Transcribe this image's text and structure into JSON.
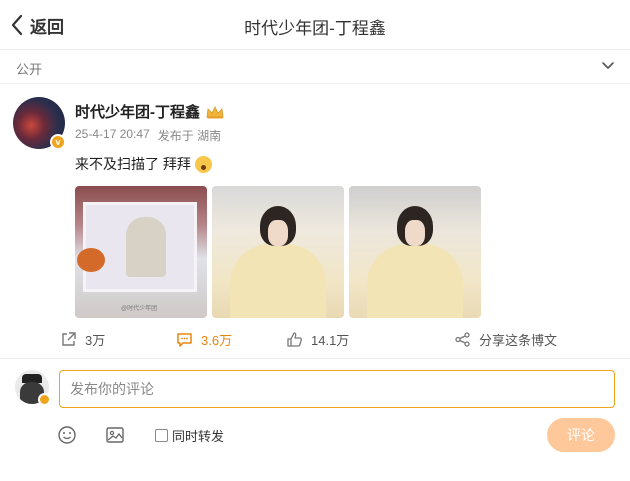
{
  "header": {
    "back_label": "返回",
    "title": "时代少年团-丁程鑫"
  },
  "visibility": {
    "label": "公开"
  },
  "post": {
    "author": "时代少年团-丁程鑫",
    "date": "25-4-17 20:47",
    "source": "发布于 湖南",
    "text": "来不及扫描了 拜拜",
    "image_watermark": "@时代少年团"
  },
  "actions": {
    "share_count": "3万",
    "comment_count": "3.6万",
    "like_count": "14.1万",
    "share_label": "分享这条博文"
  },
  "comment_box": {
    "placeholder": "发布你的评论",
    "repost_label": "同时转发",
    "submit_label": "评论"
  },
  "colors": {
    "accent": "#f0a31c",
    "highlight": "#e8850f",
    "submit_bg": "#ffc89b"
  }
}
